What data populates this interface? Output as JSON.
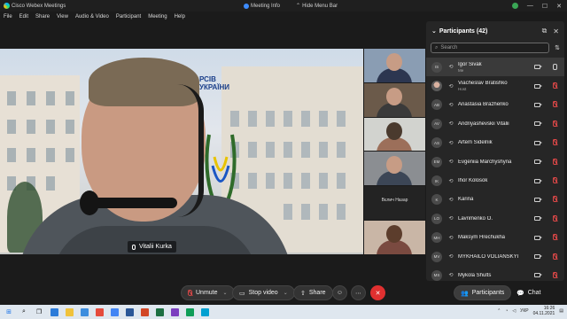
{
  "titlebar": {
    "app_title": "Cisco Webex Meetings",
    "meeting_info": "Meeting Info",
    "hide_menu": "Hide Menu Bar"
  },
  "menu": [
    "File",
    "Edit",
    "Share",
    "View",
    "Audio & Video",
    "Participant",
    "Meeting",
    "Help"
  ],
  "stage": {
    "speaker_name": "Vitalii Kurka",
    "sign_line1": "РСІВ",
    "sign_line2": "УКРАЇНИ"
  },
  "thumbnails": [
    {
      "label": ""
    },
    {
      "label": ""
    },
    {
      "label": ""
    },
    {
      "label": ""
    },
    {
      "label": "Вєлич Назар"
    },
    {
      "label": ""
    }
  ],
  "participants_panel": {
    "title": "Participants (42)",
    "search_placeholder": "Search",
    "items": [
      {
        "initials": "IS",
        "name": "Igor Sivak",
        "role": "Me",
        "highlight": true,
        "photo": false,
        "muted": false
      },
      {
        "initials": "",
        "name": "Viacheslav Bratishko",
        "role": "Host",
        "highlight": false,
        "photo": true,
        "muted": true
      },
      {
        "initials": "AB",
        "name": "Anastasia Brazhenko",
        "role": "",
        "highlight": false,
        "photo": false,
        "muted": true
      },
      {
        "initials": "AV",
        "name": "Andriyashevskii Vitalii",
        "role": "",
        "highlight": false,
        "photo": false,
        "muted": true
      },
      {
        "initials": "AS",
        "name": "Artem Sidelnik",
        "role": "",
        "highlight": false,
        "photo": false,
        "muted": true
      },
      {
        "initials": "EM",
        "name": "Evgeniia Marchyshyna",
        "role": "",
        "highlight": false,
        "photo": false,
        "muted": true
      },
      {
        "initials": "IK",
        "name": "Ihor Kolosok",
        "role": "",
        "highlight": false,
        "photo": false,
        "muted": true
      },
      {
        "initials": "K",
        "name": "Karina",
        "role": "",
        "highlight": false,
        "photo": false,
        "muted": true
      },
      {
        "initials": "LO",
        "name": "Lavrimenko O.",
        "role": "",
        "highlight": false,
        "photo": false,
        "muted": true
      },
      {
        "initials": "MH",
        "name": "Maksym Hrechukha",
        "role": "",
        "highlight": false,
        "photo": false,
        "muted": true
      },
      {
        "initials": "MV",
        "name": "MYKHAILO VOLIANSKYI",
        "role": "",
        "highlight": false,
        "photo": false,
        "muted": true
      },
      {
        "initials": "MS",
        "name": "Mykola Shults",
        "role": "",
        "highlight": false,
        "photo": false,
        "muted": true
      }
    ]
  },
  "controls": {
    "unmute": "Unmute",
    "stop_video": "Stop video",
    "share": "Share",
    "participants": "Participants",
    "chat": "Chat"
  },
  "taskbar": {
    "language": "УКР",
    "time": "16:26",
    "date": "04.11.2021"
  },
  "colors": {
    "end_call": "#e03030",
    "muted_icon": "#e04848",
    "panel_bg": "#262626"
  }
}
